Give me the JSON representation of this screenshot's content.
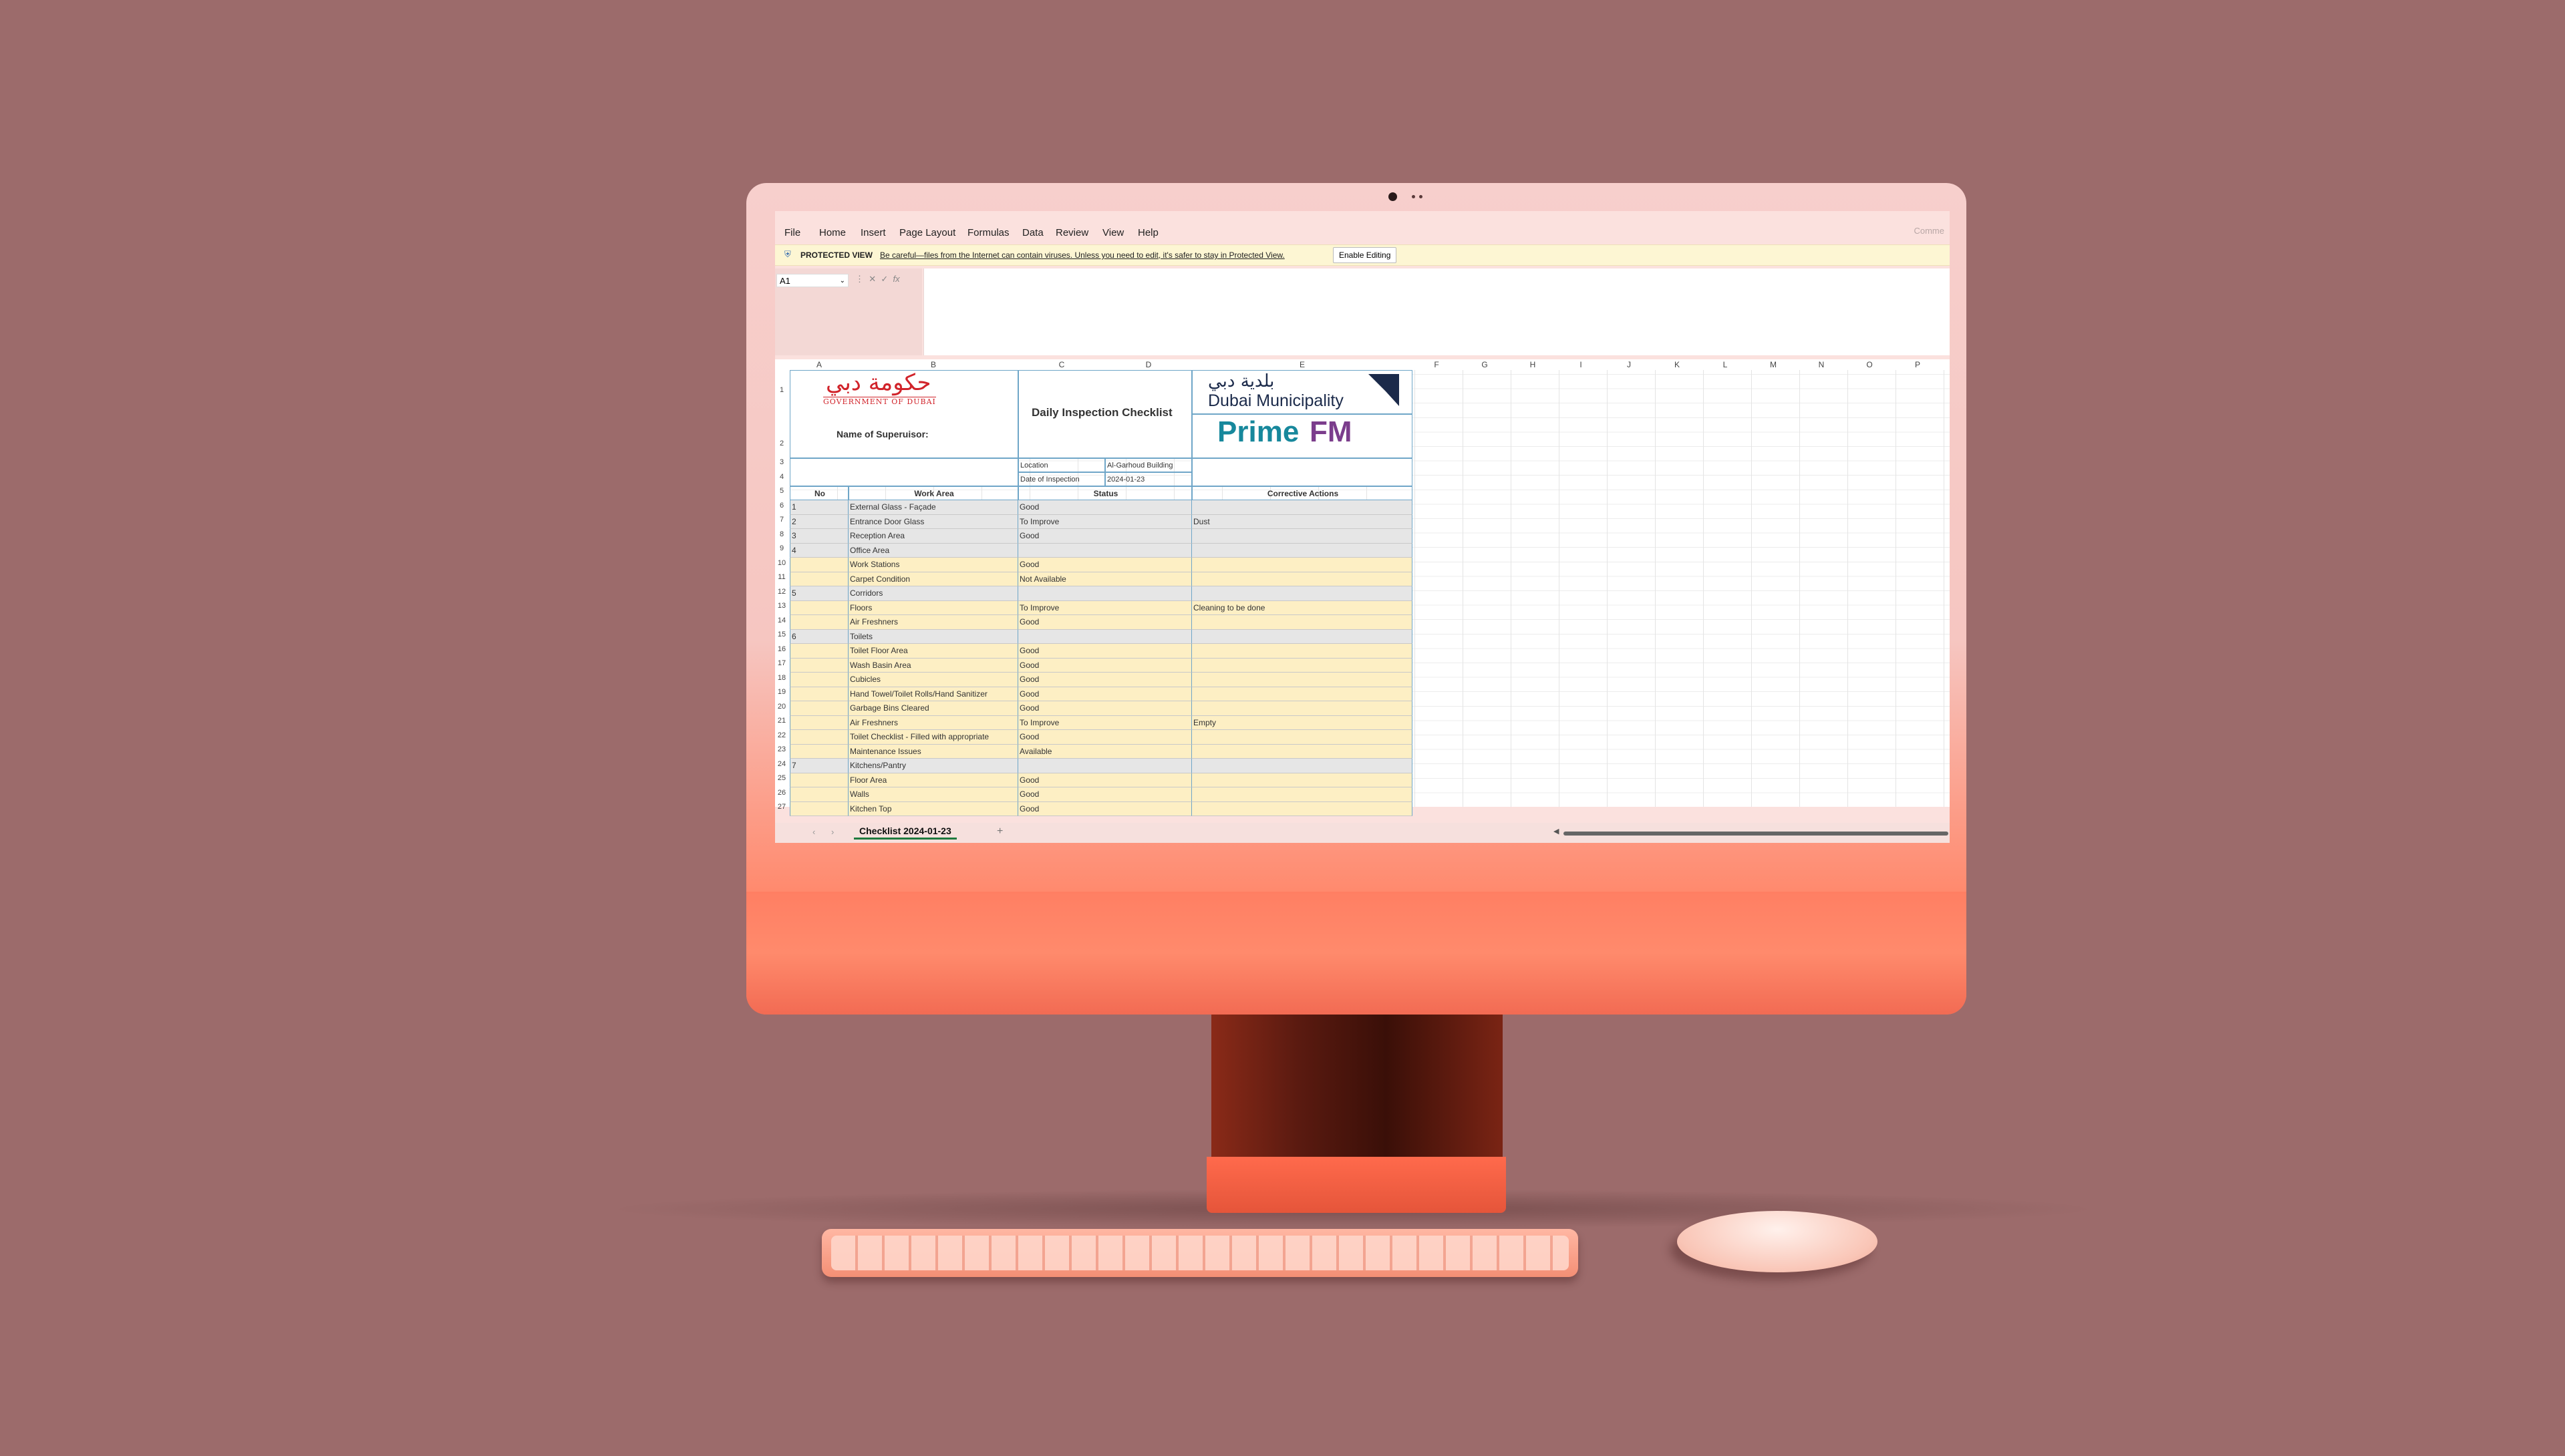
{
  "menu": [
    "File",
    "Home",
    "Insert",
    "Page Layout",
    "Formulas",
    "Data",
    "Review",
    "View",
    "Help"
  ],
  "comments_label": "Comme",
  "protected_view": {
    "title": "PROTECTED VIEW",
    "message": "Be careful—files from the Internet can contain viruses. Unless you need to edit, it's safer to stay in Protected View.",
    "button": "Enable Editing"
  },
  "name_box": "A1",
  "fx_label": "fx",
  "columns": [
    "A",
    "B",
    "C",
    "D",
    "E",
    "F",
    "G",
    "H",
    "I",
    "J",
    "K",
    "L",
    "M",
    "N",
    "O",
    "P"
  ],
  "rows": [
    "1",
    "2",
    "3",
    "4",
    "5",
    "6",
    "7",
    "8",
    "9",
    "10",
    "11",
    "12",
    "13",
    "14",
    "15",
    "16",
    "17",
    "18",
    "19",
    "20",
    "21",
    "22",
    "23",
    "24",
    "25",
    "26",
    "27"
  ],
  "header": {
    "gov_arabic": "حكومة دبي",
    "gov_english": "GOVERNMENT OF DUBAI",
    "title": "Daily Inspection Checklist",
    "dm_arabic": "بلدية دبي",
    "dm_english": "Dubai Municipality",
    "prime": "Prime",
    "fm": "FM",
    "supervisor_label": "Name of Superuisor:",
    "location_label": "Location",
    "location_value": "Al-Garhoud Building",
    "date_label": "Date of Inspection",
    "date_value": "2024-01-23"
  },
  "table_headers": {
    "no": "No",
    "work_area": "Work Area",
    "status": "Status",
    "corrective": "Corrective Actions"
  },
  "items": [
    {
      "no": "1",
      "area": "External Glass - Façade",
      "status": "Good",
      "action": "",
      "style": "grey"
    },
    {
      "no": "2",
      "area": "Entrance Door Glass",
      "status": "To Improve",
      "action": "Dust",
      "style": "grey"
    },
    {
      "no": "3",
      "area": "Reception Area",
      "status": "Good",
      "action": "",
      "style": "grey"
    },
    {
      "no": "4",
      "area": "Office Area",
      "status": "",
      "action": "",
      "style": "grey"
    },
    {
      "no": "",
      "area": "Work Stations",
      "status": "Good",
      "action": "",
      "style": "yellow"
    },
    {
      "no": "",
      "area": "Carpet Condition",
      "status": "Not Available",
      "action": "",
      "style": "yellow"
    },
    {
      "no": "5",
      "area": "Corridors",
      "status": "",
      "action": "",
      "style": "grey"
    },
    {
      "no": "",
      "area": "Floors",
      "status": "To Improve",
      "action": "Cleaning to be done",
      "style": "yellow"
    },
    {
      "no": "",
      "area": "Air Freshners",
      "status": "Good",
      "action": "",
      "style": "yellow"
    },
    {
      "no": "6",
      "area": "Toilets",
      "status": "",
      "action": "",
      "style": "grey"
    },
    {
      "no": "",
      "area": "Toilet Floor Area",
      "status": "Good",
      "action": "",
      "style": "yellow"
    },
    {
      "no": "",
      "area": "Wash Basin Area",
      "status": "Good",
      "action": "",
      "style": "yellow"
    },
    {
      "no": "",
      "area": "Cubicles",
      "status": "Good",
      "action": "",
      "style": "yellow"
    },
    {
      "no": "",
      "area": "Hand Towel/Toilet Rolls/Hand Sanitizer",
      "status": "Good",
      "action": "",
      "style": "yellow"
    },
    {
      "no": "",
      "area": "Garbage Bins Cleared",
      "status": "Good",
      "action": "",
      "style": "yellow"
    },
    {
      "no": "",
      "area": "Air Freshners",
      "status": "To Improve",
      "action": "Empty",
      "style": "yellow"
    },
    {
      "no": "",
      "area": "Toilet Checklist - Filled with appropriate",
      "status": "Good",
      "action": "",
      "style": "yellow"
    },
    {
      "no": "",
      "area": "Maintenance Issues",
      "status": "Available",
      "action": "",
      "style": "yellow"
    },
    {
      "no": "7",
      "area": "Kitchens/Pantry",
      "status": "",
      "action": "",
      "style": "grey"
    },
    {
      "no": "",
      "area": "Floor Area",
      "status": "Good",
      "action": "",
      "style": "yellow"
    },
    {
      "no": "",
      "area": "Walls",
      "status": "Good",
      "action": "",
      "style": "yellow"
    },
    {
      "no": "",
      "area": "Kitchen Top",
      "status": "Good",
      "action": "",
      "style": "yellow"
    }
  ],
  "sheet_tab": "Checklist 2024-01-23",
  "add_tab": "+",
  "colors": {
    "accent": "#1f7a3e",
    "yellow_row": "#fdefc4",
    "grey_row": "#e6e6e6",
    "imac": "#ff7b5e",
    "background": "#9c6b6b"
  }
}
